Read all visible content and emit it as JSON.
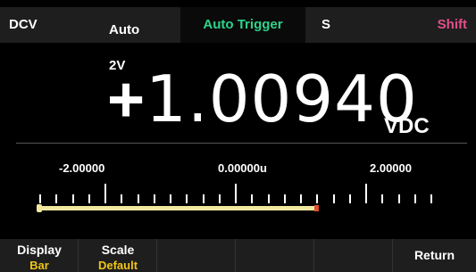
{
  "status": {
    "mode": "DCV",
    "range_line1": "Auto",
    "range_line2": "2V",
    "trigger": "Auto Trigger",
    "rate": "S",
    "shift": "Shift"
  },
  "measurement": {
    "sign": "+",
    "value": "1.00940",
    "unit": "VDC"
  },
  "bar_graph": {
    "labels": [
      "-2.00000",
      "0.00000u",
      "2.00000"
    ],
    "level_fraction": 0.752
  },
  "softkeys": [
    {
      "label": "Display",
      "value": "Bar"
    },
    {
      "label": "Scale",
      "value": "Default"
    },
    {
      "label": "",
      "value": ""
    },
    {
      "label": "",
      "value": ""
    },
    {
      "label": "",
      "value": ""
    },
    {
      "label": "Return",
      "value": ""
    }
  ],
  "colors": {
    "trigger": "#2ed38a",
    "shift": "#e0508a",
    "softkey_value": "#f0c419",
    "bar_fill": "#f1e8a0",
    "bar_end": "#e0502e"
  }
}
